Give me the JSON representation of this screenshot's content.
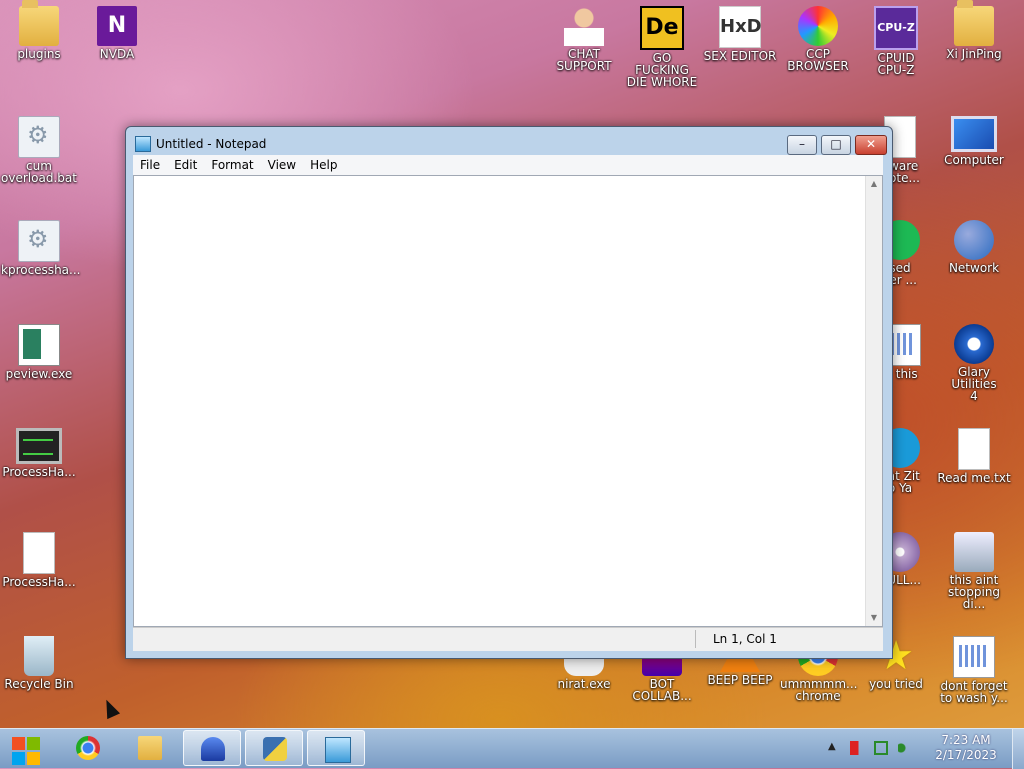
{
  "desktop": {
    "left_icons": [
      {
        "label": "plugins",
        "icon": "folder-icon"
      },
      {
        "label": "cum\noverload.bat",
        "icon": "batch-file-icon"
      },
      {
        "label": "kprocessha...",
        "icon": "batch-file-icon"
      },
      {
        "label": "peview.exe",
        "icon": "peview-icon"
      },
      {
        "label": "ProcessHa...",
        "icon": "monitor-icon"
      },
      {
        "label": "ProcessHa...",
        "icon": "file-icon"
      },
      {
        "label": "Recycle Bin",
        "icon": "recycle-bin-icon"
      }
    ],
    "nvda_label": "NVDA",
    "top_icons": [
      {
        "label": "CHAT\nSUPPORT",
        "icon": "doctor-icon"
      },
      {
        "label": "GO FUCKING\nDIE WHORE",
        "icon": "de-icon"
      },
      {
        "label": "SEX EDITOR",
        "icon": "hxd-icon"
      },
      {
        "label": "CCP\nBROWSER",
        "icon": "ccp-browser-icon"
      },
      {
        "label": "CPUID\nCPU-Z",
        "icon": "cpuz-icon"
      },
      {
        "label": "Xi JinPing",
        "icon": "user-folder-icon"
      }
    ],
    "right_icons": [
      {
        "label": "Computer",
        "icon": "computer-icon"
      },
      {
        "label": "Network",
        "icon": "network-icon"
      },
      {
        "label": "Glary Utilities\n4",
        "icon": "glary-icon"
      },
      {
        "label": "Read me.txt",
        "icon": "text-file-icon"
      },
      {
        "label": "this aint\nstopping di...",
        "icon": "wrench-icon"
      },
      {
        "label": "dont forget\nto wash y...",
        "icon": "calendar-file-icon"
      }
    ],
    "partial_icons": [
      {
        "label": "eware\nNote...",
        "icon": "document-icon"
      },
      {
        "label": "sed\nser ...",
        "icon": "spotify-icon"
      },
      {
        "label": "is this",
        "icon": "calendar-file-icon"
      },
      {
        "label": "hat Zit\no Ya",
        "icon": "skype-icon"
      },
      {
        "label": "BULL...",
        "icon": "disc-icon"
      }
    ],
    "bottom_icons": [
      {
        "label": "nirat.exe",
        "icon": "skull-icon"
      },
      {
        "label": "BOT\nCOLLAB...",
        "icon": "bot-icon"
      },
      {
        "label": "BEEP BEEP",
        "icon": "vlc-icon"
      },
      {
        "label": "ummmmm...\nchrome",
        "icon": "chrome-icon"
      },
      {
        "label": "you tried",
        "icon": "star-icon"
      }
    ]
  },
  "notepad": {
    "title": "Untitled - Notepad",
    "menu": [
      "File",
      "Edit",
      "Format",
      "View",
      "Help"
    ],
    "content": "",
    "status": "Ln 1, Col 1",
    "controls": {
      "minimize": "–",
      "maximize": "□",
      "close": "✕"
    }
  },
  "taskbar": {
    "clock_time": "7:23 AM",
    "clock_date": "2/17/2023",
    "tray_arrow": "▲"
  }
}
